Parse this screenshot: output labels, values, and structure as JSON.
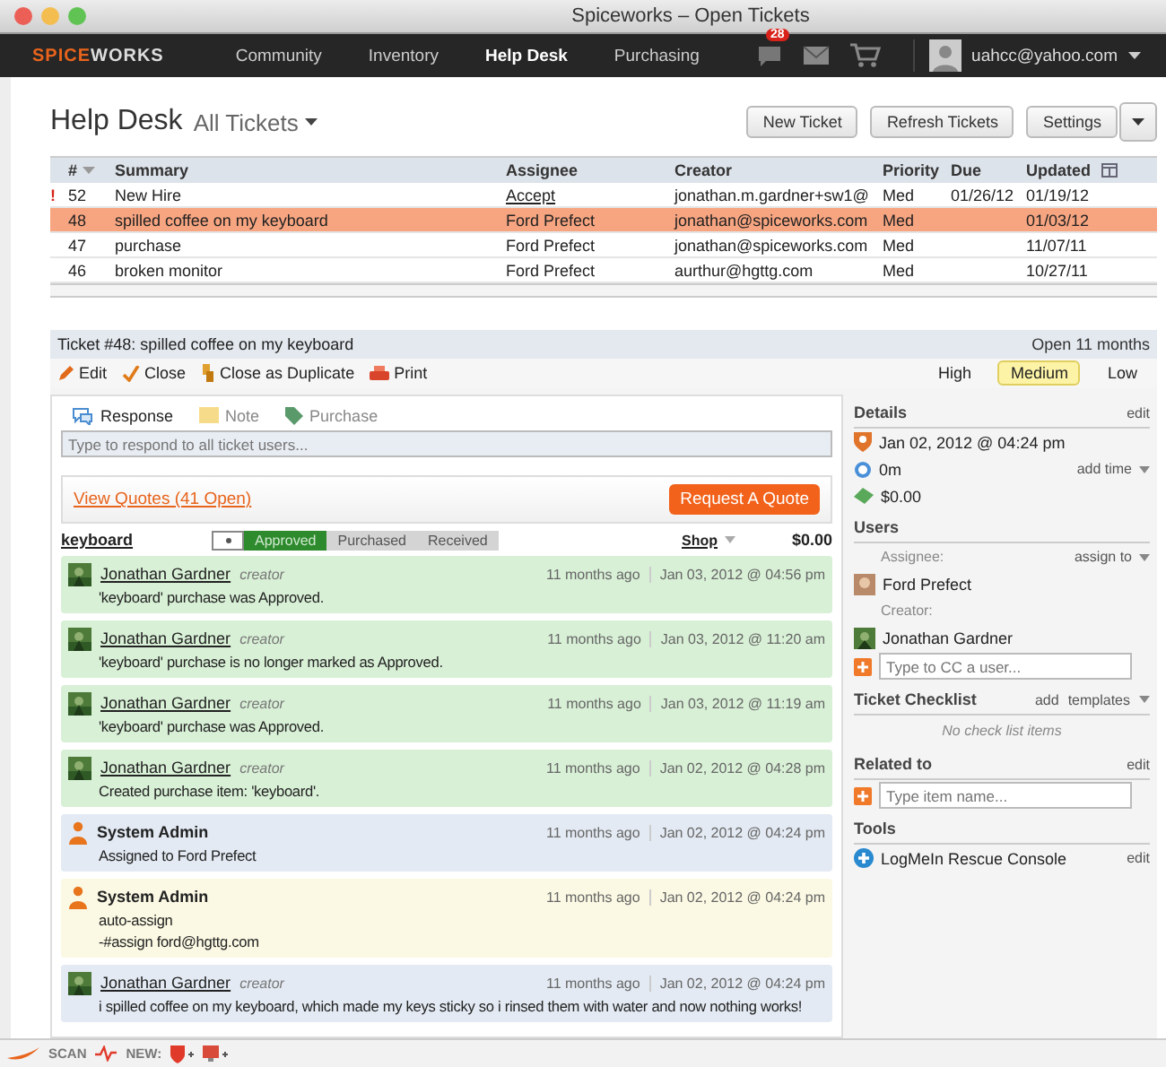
{
  "window": {
    "title": "Spiceworks – Open Tickets"
  },
  "nav": {
    "logo_accent": "SPICE",
    "logo_rest": "WORKS",
    "items": [
      {
        "label": "Community",
        "selected": false
      },
      {
        "label": "Inventory",
        "selected": false
      },
      {
        "label": "Help Desk",
        "selected": true
      },
      {
        "label": "Purchasing",
        "selected": false
      }
    ],
    "notification_count": "28",
    "user": "uahcc@yahoo.com"
  },
  "header": {
    "title": "Help Desk",
    "filter": "All Tickets",
    "buttons": [
      "New Ticket",
      "Refresh Tickets",
      "Settings"
    ]
  },
  "table": {
    "columns": [
      "#",
      "Summary",
      "Assignee",
      "Creator",
      "Priority",
      "Due",
      "Updated"
    ],
    "rows": [
      {
        "flag": "!",
        "number": "52",
        "summary": "New Hire",
        "assignee": "Accept",
        "assignee_link": true,
        "creator": "jonathan.m.gardner+sw1@",
        "priority": "Med",
        "due": "01/26/12",
        "updated": "01/19/12",
        "selected": false
      },
      {
        "number": "48",
        "summary": "spilled coffee on my keyboard",
        "assignee": "Ford Prefect",
        "assignee_link": false,
        "creator": "jonathan@spiceworks.com",
        "priority": "Med",
        "updated": "01/03/12",
        "selected": true
      },
      {
        "number": "47",
        "summary": "purchase",
        "assignee": "Ford Prefect",
        "assignee_link": false,
        "creator": "jonathan@spiceworks.com",
        "priority": "Med",
        "updated": "11/07/11",
        "selected": false
      },
      {
        "number": "46",
        "summary": "broken monitor",
        "assignee": "Ford Prefect",
        "assignee_link": false,
        "creator": "aurthur@hgttg.com",
        "priority": "Med",
        "updated": "10/27/11",
        "selected": false
      }
    ]
  },
  "ticket": {
    "title": "Ticket #48: spilled coffee on my keyboard",
    "age": "Open 11 months",
    "actions": [
      {
        "label": "Edit",
        "kind": "edit"
      },
      {
        "label": "Close",
        "kind": "close"
      },
      {
        "label": "Close as Duplicate",
        "kind": "duplicate"
      },
      {
        "label": "Print",
        "kind": "print"
      }
    ],
    "priorities": [
      {
        "label": "High",
        "selected": false
      },
      {
        "label": "Medium",
        "selected": true
      },
      {
        "label": "Low",
        "selected": false
      }
    ],
    "tabs": [
      {
        "label": "Response",
        "kind": "response",
        "selected": true
      },
      {
        "label": "Note",
        "kind": "note",
        "selected": false
      },
      {
        "label": "Purchase",
        "kind": "purchase",
        "selected": false
      }
    ],
    "response_placeholder": "Type to respond to all ticket users...",
    "quotes_link": "View Quotes (41 Open)",
    "quote_button": "Request A Quote",
    "purchase": {
      "item": "keyboard",
      "steps": [
        {
          "label": "Approved",
          "selected": true
        },
        {
          "label": "Purchased",
          "selected": false
        },
        {
          "label": "Received",
          "selected": false
        }
      ],
      "shop": "Shop",
      "price": "$0.00"
    },
    "activity": [
      {
        "kind": "user",
        "author": "Jonathan Gardner",
        "role": "creator",
        "ago": "11 months ago",
        "date": "Jan 03, 2012 @ 04:56 pm",
        "lines": [
          "'keyboard' purchase was Approved."
        ],
        "color": "#d8f0d6"
      },
      {
        "kind": "user",
        "author": "Jonathan Gardner",
        "role": "creator",
        "ago": "11 months ago",
        "date": "Jan 03, 2012 @ 11:20 am",
        "lines": [
          "'keyboard' purchase is no longer marked as Approved."
        ],
        "color": "#d8f0d6"
      },
      {
        "kind": "user",
        "author": "Jonathan Gardner",
        "role": "creator",
        "ago": "11 months ago",
        "date": "Jan 03, 2012 @ 11:19 am",
        "lines": [
          "'keyboard' purchase was Approved."
        ],
        "color": "#d8f0d6"
      },
      {
        "kind": "user",
        "author": "Jonathan Gardner",
        "role": "creator",
        "ago": "11 months ago",
        "date": "Jan 02, 2012 @ 04:28 pm",
        "lines": [
          "Created purchase item: 'keyboard'."
        ],
        "color": "#d8f0d6"
      },
      {
        "kind": "admin",
        "author": "System Admin",
        "ago": "11 months ago",
        "date": "Jan 02, 2012 @ 04:24 pm",
        "lines": [
          "Assigned to Ford Prefect"
        ],
        "color": "#e3eaf3"
      },
      {
        "kind": "admin",
        "author": "System Admin",
        "ago": "11 months ago",
        "date": "Jan 02, 2012 @ 04:24 pm",
        "lines": [
          "auto-assign",
          "-#assign ford@hgttg.com"
        ],
        "color": "#fbf9e3"
      },
      {
        "kind": "user",
        "author": "Jonathan Gardner",
        "role": "creator",
        "ago": "11 months ago",
        "date": "Jan 02, 2012 @ 04:24 pm",
        "lines": [
          "i spilled coffee on my keyboard, which made my keys sticky so i rinsed them with water and now nothing works!"
        ],
        "color": "#e3eaf3"
      }
    ]
  },
  "sidebar": {
    "details": {
      "title": "Details",
      "edit": "edit",
      "date": "Jan 02, 2012 @ 04:24 pm",
      "time": "0m",
      "add_time": "add time",
      "cost": "$0.00"
    },
    "users": {
      "title": "Users",
      "assignee_label": "Assignee:",
      "assign_to": "assign to",
      "assignee": "Ford Prefect",
      "creator_label": "Creator:",
      "creator": "Jonathan Gardner",
      "cc_placeholder": "Type to CC a user..."
    },
    "checklist": {
      "title": "Ticket Checklist",
      "add": "add",
      "templates": "templates",
      "empty": "No check list items"
    },
    "related": {
      "title": "Related to",
      "edit": "edit",
      "placeholder": "Type item name..."
    },
    "tools": {
      "title": "Tools",
      "items": [
        {
          "label": "LogMeIn Rescue Console",
          "edit": "edit"
        }
      ]
    }
  },
  "status_bar": {
    "scan": "SCAN",
    "new": "NEW:"
  }
}
